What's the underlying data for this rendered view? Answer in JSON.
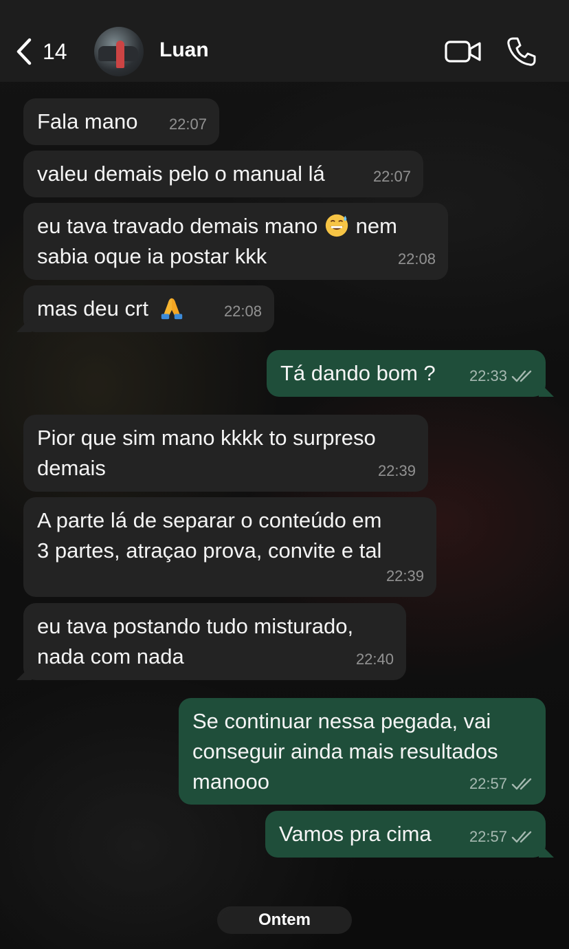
{
  "header": {
    "back_count": "14",
    "contact_name": "Luan"
  },
  "messages": [
    {
      "direction": "in",
      "text": "Fala mano",
      "time": "22:07"
    },
    {
      "direction": "in",
      "text": "valeu demais pelo o manual lá",
      "time": "22:07"
    },
    {
      "direction": "in",
      "text_before_emoji": "eu tava travado demais mano",
      "emoji": "sweat-smile-emoji",
      "text_after_emoji": "nem",
      "text_line2": "sabia oque ia postar kkk",
      "time": "22:08"
    },
    {
      "direction": "in",
      "text": "mas deu crt",
      "emoji": "folded-hands-emoji",
      "time": "22:08"
    },
    {
      "direction": "out",
      "text": "Tá dando bom ?",
      "time": "22:33",
      "status": "read"
    },
    {
      "direction": "in",
      "text_line1": "Pior que sim mano kkkk to surpreso",
      "text_line2": "demais",
      "time": "22:39"
    },
    {
      "direction": "in",
      "text_line1": "A parte lá de separar o conteúdo em",
      "text_line2": "3 partes, atraçao prova, convite e tal",
      "time": "22:39"
    },
    {
      "direction": "in",
      "text_line1": "eu tava postando tudo misturado,",
      "text_line2": "nada com nada",
      "time": "22:40"
    },
    {
      "direction": "out",
      "text_line1": "Se continuar nessa pegada, vai",
      "text_line2": "conseguir ainda mais resultados",
      "text_line3": "manooo",
      "time": "22:57",
      "status": "read"
    },
    {
      "direction": "out",
      "text": "Vamos pra cima",
      "time": "22:57",
      "status": "read"
    }
  ],
  "date_separator": "Ontem",
  "colors": {
    "incoming_bubble": "#232323",
    "outgoing_bubble": "#1f4e3a",
    "header": "#1e1e1e"
  }
}
